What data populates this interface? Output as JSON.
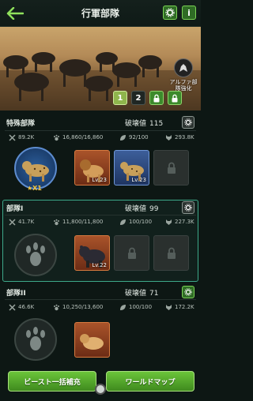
{
  "header": {
    "title": "行軍部隊",
    "info_label": "i"
  },
  "banner": {
    "alpha_label": "アルファ部隊強化",
    "tabs": [
      {
        "label": "1",
        "state": "active"
      },
      {
        "label": "2",
        "state": "normal"
      },
      {
        "label": "",
        "state": "locked"
      },
      {
        "label": "",
        "state": "locked"
      }
    ]
  },
  "sections": [
    {
      "title": "特殊部隊",
      "power_label": "破壊値",
      "power_value": "115",
      "stats": {
        "attack": "89.2K",
        "paw": "16,860/16,860",
        "food": "92/100",
        "wolf": "293.8K"
      },
      "leader_stars": "★X1",
      "slots": [
        {
          "level": "Lv.23"
        },
        {
          "level": "Lv.23"
        }
      ]
    },
    {
      "title": "部隊I",
      "power_label": "破壊値",
      "power_value": "99",
      "stats": {
        "attack": "41.7K",
        "paw": "11,800/11,800",
        "food": "100/100",
        "wolf": "227.3K"
      },
      "slots": [
        {
          "level": "Lv.22"
        }
      ]
    },
    {
      "title": "部隊II",
      "power_label": "破壊値",
      "power_value": "71",
      "stats": {
        "attack": "46.6K",
        "paw": "10,250/13,600",
        "food": "100/100",
        "wolf": "172.2K"
      }
    }
  ],
  "bottom": {
    "left_button": "ビースト一括補充",
    "right_button": "ワールドマップ"
  },
  "colors": {
    "accent_green": "#6bc43a",
    "selected_border": "#3da98a"
  }
}
